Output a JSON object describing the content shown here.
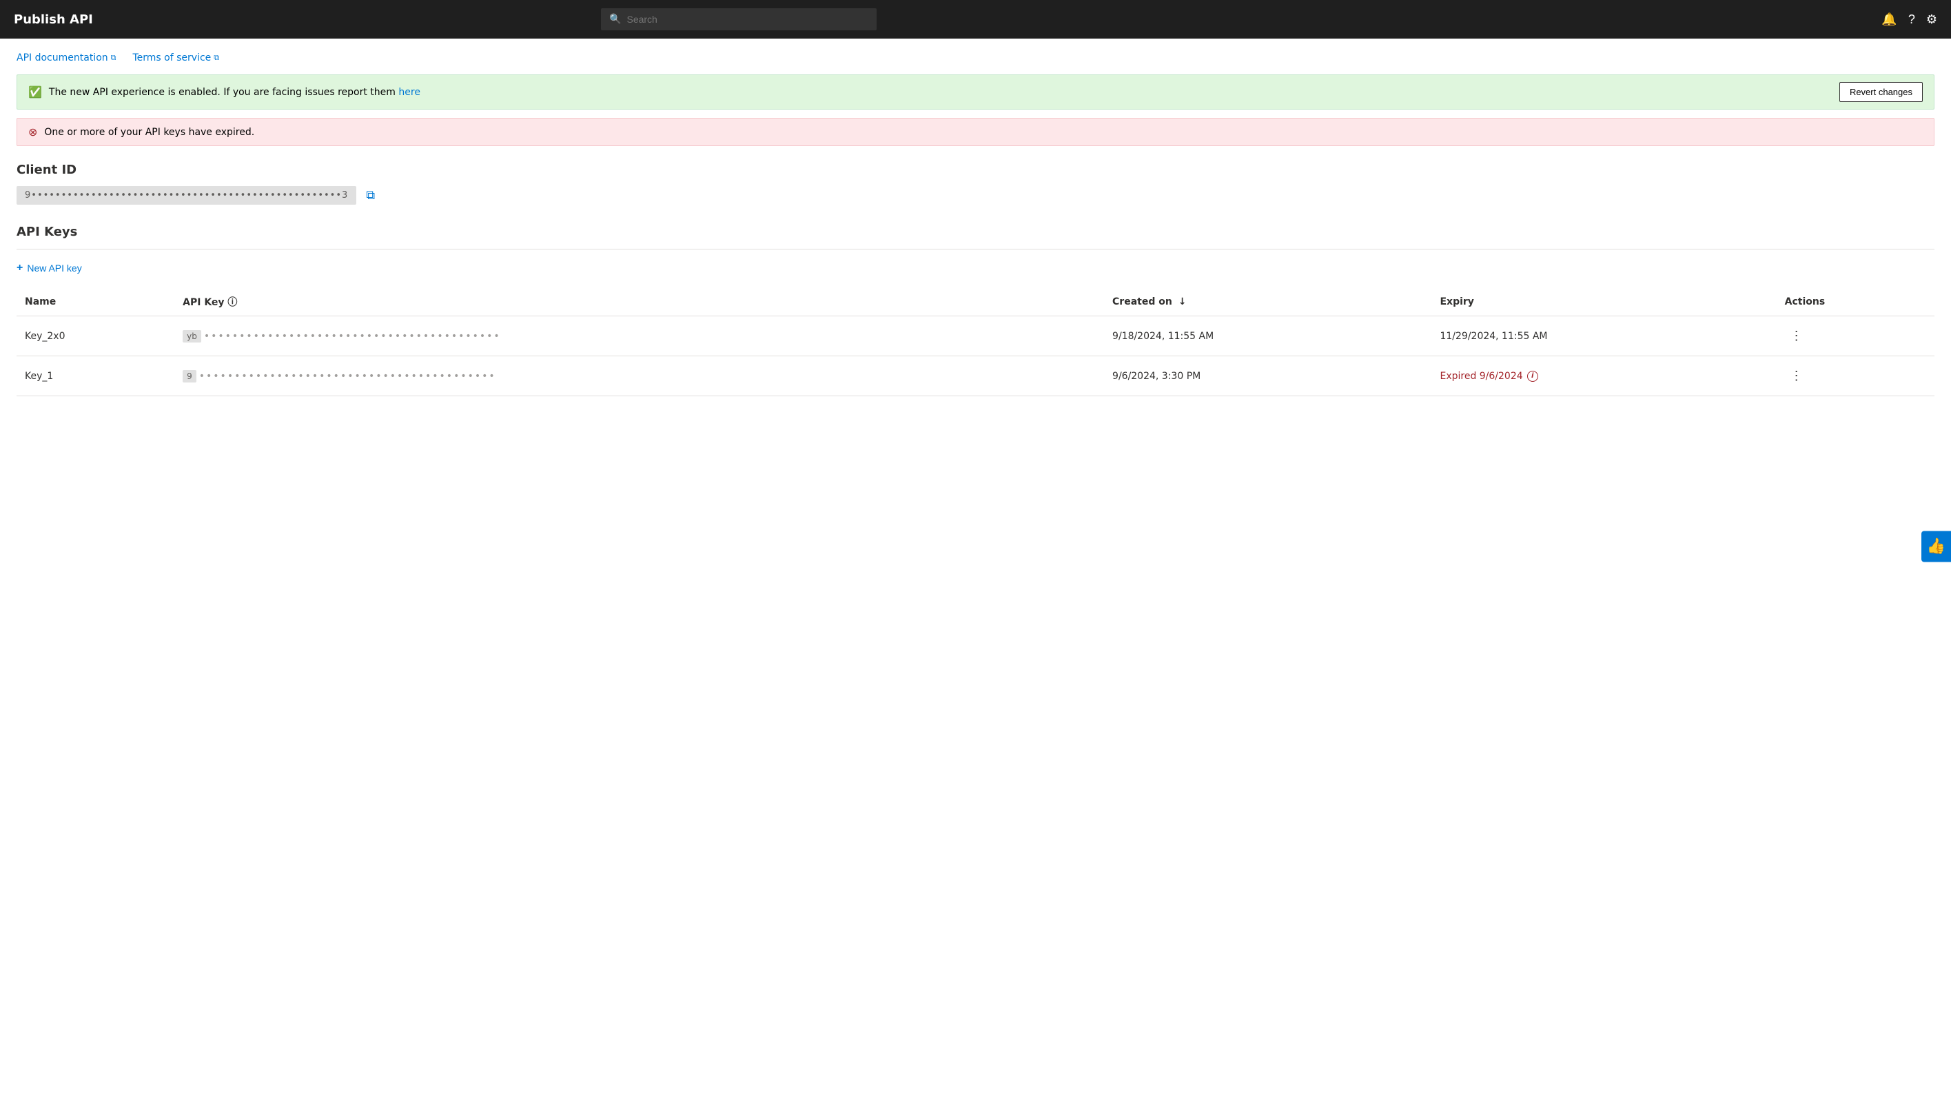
{
  "header": {
    "title": "Publish API",
    "search_placeholder": "Search",
    "nav_icons": [
      "bell",
      "help",
      "settings"
    ]
  },
  "breadcrumbs": [
    {
      "label": "API documentation",
      "icon": "external-link"
    },
    {
      "label": "Terms of service",
      "icon": "external-link"
    }
  ],
  "alerts": {
    "success": {
      "text": "The new API experience is enabled. If you are facing issues report them",
      "link_text": "here",
      "link_href": "#"
    },
    "revert_label": "Revert changes",
    "error": {
      "text": "One or more of your API keys have expired."
    }
  },
  "client_id": {
    "section_title": "Client ID",
    "value_start": "9",
    "value_end": "3",
    "masked_value": "9••••••••••••••••••••••••••••••••••••••••••••••••••••3",
    "copy_tooltip": "Copy"
  },
  "api_keys": {
    "section_title": "API Keys",
    "new_key_label": "New API key",
    "columns": {
      "name": "Name",
      "api_key": "API Key",
      "api_key_info": "ⓘ",
      "created_on": "Created on",
      "sort_arrow": "↓",
      "expiry": "Expiry",
      "actions": "Actions"
    },
    "rows": [
      {
        "name": "Key_2x0",
        "key_prefix": "yb",
        "key_masked": "••••••••••••••••••••••••••••••••••••••••••",
        "created_on": "9/18/2024, 11:55 AM",
        "expiry": "11/29/2024, 11:55 AM",
        "expiry_status": "normal"
      },
      {
        "name": "Key_1",
        "key_prefix": "9",
        "key_masked": "••••••••••••••••••••••••••••••••••••••••••",
        "created_on": "9/6/2024, 3:30 PM",
        "expiry": "Expired 9/6/2024",
        "expiry_status": "expired"
      }
    ]
  },
  "thumb_icon": "👍"
}
